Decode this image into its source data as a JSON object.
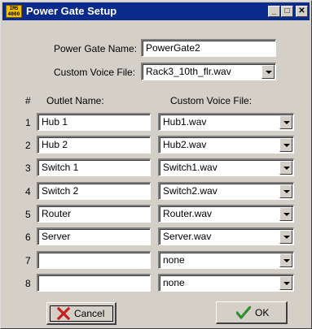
{
  "window": {
    "title": "Power Gate Setup",
    "icon_label": "IMS 4000",
    "controls": {
      "minimize": "_",
      "maximize": "□",
      "close": "✕"
    }
  },
  "form": {
    "name_label": "Power Gate Name:",
    "name_value": "PowerGate2",
    "voice_label": "Custom Voice File:",
    "voice_value": "Rack3_10th_flr.wav"
  },
  "table": {
    "headers": {
      "num": "#",
      "outlet": "Outlet Name:",
      "voice": "Custom Voice File:"
    },
    "rows": [
      {
        "num": "1",
        "outlet": "Hub 1",
        "voice": "Hub1.wav"
      },
      {
        "num": "2",
        "outlet": "Hub 2",
        "voice": "Hub2.wav"
      },
      {
        "num": "3",
        "outlet": "Switch 1",
        "voice": "Switch1.wav"
      },
      {
        "num": "4",
        "outlet": "Switch 2",
        "voice": "Switch2.wav"
      },
      {
        "num": "5",
        "outlet": "Router",
        "voice": "Router.wav"
      },
      {
        "num": "6",
        "outlet": "Server",
        "voice": "Server.wav"
      },
      {
        "num": "7",
        "outlet": "",
        "voice": "none"
      },
      {
        "num": "8",
        "outlet": "",
        "voice": "none"
      }
    ]
  },
  "buttons": {
    "cancel": "Cancel",
    "ok": "OK"
  },
  "icons": {
    "cancel": "red-x-icon",
    "ok": "green-check-icon",
    "combo": "chevron-down-icon"
  },
  "colors": {
    "titlebar": "#0a2a8c",
    "face": "#d4d0c8",
    "cancel_icon": "#c81e1e",
    "ok_icon": "#2f8f2f"
  }
}
